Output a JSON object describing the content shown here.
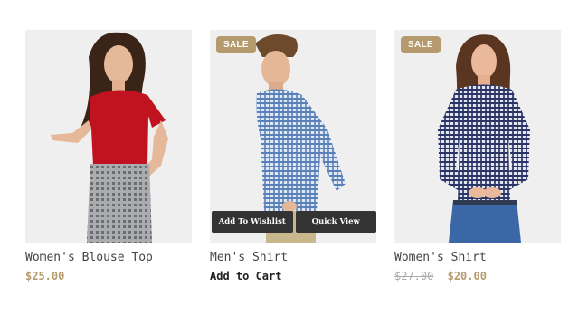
{
  "products": [
    {
      "name": "Women's Blouse Top",
      "price": "$25.00",
      "image_alt": "woman wearing red blouse and checked trousers",
      "on_sale": false
    },
    {
      "name": "Men's Shirt",
      "badge": "SALE",
      "add_to_cart": "Add to Cart",
      "actions": {
        "wishlist": "Add To Wishlist",
        "quick_view": "Quick View"
      },
      "image_alt": "man wearing blue gingham shirt",
      "on_sale": true
    },
    {
      "name": "Women's Shirt",
      "badge": "SALE",
      "old_price": "$27.00",
      "price": "$20.00",
      "image_alt": "woman wearing navy gingham shirt and jeans",
      "on_sale": true
    }
  ],
  "colors": {
    "accent": "#b49a6c",
    "button_dark": "#333333"
  }
}
